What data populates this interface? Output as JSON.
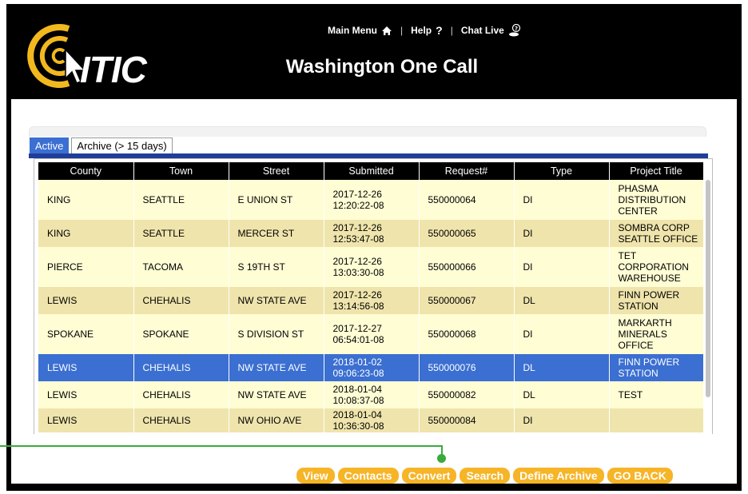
{
  "header": {
    "logo_text": "ITIC",
    "nav": {
      "main_menu": "Main Menu",
      "help": "Help",
      "chat_live": "Chat Live",
      "separator": "|"
    },
    "title": "Washington One Call"
  },
  "tabs": [
    {
      "label": "Active",
      "active": true
    },
    {
      "label": "Archive (> 15 days)",
      "active": false
    }
  ],
  "table": {
    "columns": [
      "County",
      "Town",
      "Street",
      "Submitted",
      "Request#",
      "Type",
      "Project Title"
    ],
    "rows": [
      {
        "county": "KING",
        "town": "SEATTLE",
        "street": "E UNION ST",
        "submitted_date": "2017-12-26",
        "submitted_time": "12:20:22-08",
        "request": "550000064",
        "type": "DI",
        "title": "PHASMA DISTRIBUTION CENTER"
      },
      {
        "county": "KING",
        "town": "SEATTLE",
        "street": "MERCER ST",
        "submitted_date": "2017-12-26",
        "submitted_time": "12:53:47-08",
        "request": "550000065",
        "type": "DI",
        "title": "SOMBRA CORP SEATTLE OFFICE"
      },
      {
        "county": "PIERCE",
        "town": "TACOMA",
        "street": "S 19TH ST",
        "submitted_date": "2017-12-26",
        "submitted_time": "13:03:30-08",
        "request": "550000066",
        "type": "DI",
        "title": "TET CORPORATION WAREHOUSE"
      },
      {
        "county": "LEWIS",
        "town": "CHEHALIS",
        "street": "NW STATE AVE",
        "submitted_date": "2017-12-26",
        "submitted_time": "13:14:56-08",
        "request": "550000067",
        "type": "DL",
        "title": "FINN POWER STATION"
      },
      {
        "county": "SPOKANE",
        "town": "SPOKANE",
        "street": "S DIVISION ST",
        "submitted_date": "2017-12-27",
        "submitted_time": "06:54:01-08",
        "request": "550000068",
        "type": "DI",
        "title": "MARKARTH MINERALS OFFICE"
      },
      {
        "county": "LEWIS",
        "town": "CHEHALIS",
        "street": "NW STATE AVE",
        "submitted_date": "2018-01-02",
        "submitted_time": "09:06:23-08",
        "request": "550000076",
        "type": "DL",
        "title": "FINN POWER STATION"
      },
      {
        "county": "LEWIS",
        "town": "CHEHALIS",
        "street": "NW STATE AVE",
        "submitted_date": "2018-01-04",
        "submitted_time": "10:08:37-08",
        "request": "550000082",
        "type": "DL",
        "title": "TEST"
      },
      {
        "county": "LEWIS",
        "town": "CHEHALIS",
        "street": "NW OHIO AVE",
        "submitted_date": "2018-01-04",
        "submitted_time": "10:36:30-08",
        "request": "550000084",
        "type": "DI",
        "title": ""
      }
    ],
    "selected_index": 5
  },
  "buttons": {
    "view": "View",
    "contacts": "Contacts",
    "convert": "Convert",
    "search": "Search",
    "define_archive": "Define Archive",
    "go_back": "GO BACK"
  },
  "colors": {
    "accent_blue": "#3b6fd1",
    "row_light": "#fffdd4",
    "row_dark": "#efe4ac",
    "button_orange": "#f6b427",
    "logo_yellow": "#f2b81e",
    "connector_green": "#3aaa3a"
  }
}
